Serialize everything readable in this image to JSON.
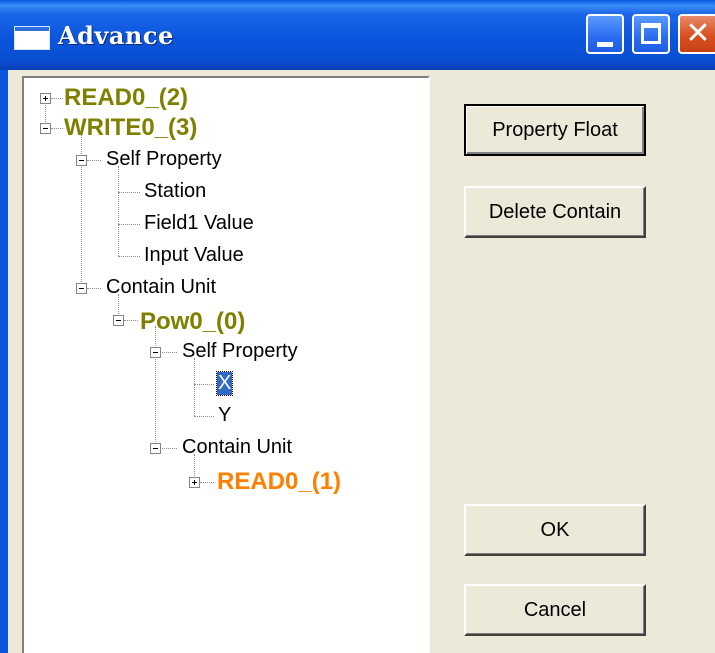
{
  "window": {
    "title": "Advance",
    "icon": "window-app-icon",
    "controls": [
      "minimize-icon",
      "maximize-icon",
      "close-icon"
    ]
  },
  "tree": {
    "read0_2": "READ0_(2)",
    "write0_3": "WRITE0_(3)",
    "self_property": "Self Property",
    "station": "Station",
    "field1_value": "Field1 Value",
    "input_value": "Input Value",
    "contain_unit": "Contain Unit",
    "pow0_0": "Pow0_(0)",
    "pow_self_property": "Self Property",
    "x": "X",
    "y": "Y",
    "pow_contain_unit": "Contain Unit",
    "read0_1": "READ0_(1)",
    "selected_item": "X"
  },
  "buttons": {
    "property_float": "Property Float",
    "delete_contain": "Delete Contain",
    "ok": "OK",
    "cancel": "Cancel"
  },
  "colors": {
    "titlebar": "#0b55dc",
    "close_button": "#d8501e",
    "node_olive": "#808000",
    "node_orange": "#ff8000",
    "selection": "#316ac5",
    "dialog_face": "#ece9d8"
  }
}
